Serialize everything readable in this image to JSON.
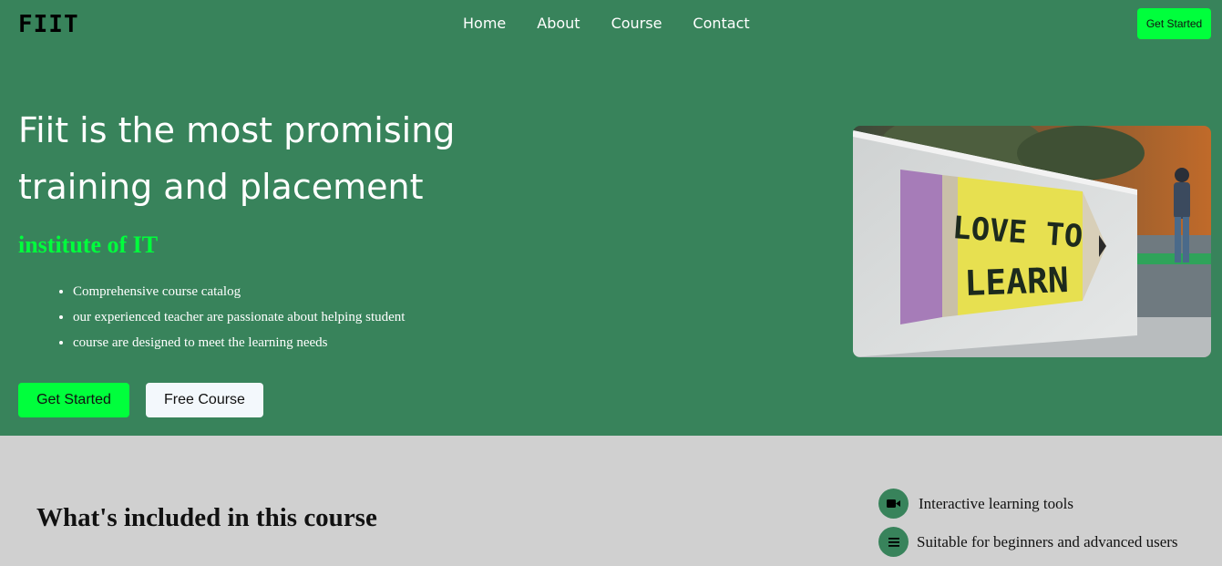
{
  "nav": {
    "logo": "FIIT",
    "links": [
      "Home",
      "About",
      "Course",
      "Contact"
    ],
    "cta_label": "Get Started"
  },
  "hero": {
    "title": "Fiit is the most promising training and placement",
    "subtitle": "institute of IT",
    "features": [
      "Comprehensive course catalog",
      "our experienced teacher are passionate about helping student",
      "course are designed to meet the learning needs"
    ],
    "primary_button": "Get Started",
    "secondary_button": "Free Course",
    "image_text_line1": "LOVE TO",
    "image_text_line2": "LEARN"
  },
  "course": {
    "heading": "What's included in this course",
    "items": [
      {
        "icon": "video-camera-icon",
        "label": "Interactive learning tools"
      },
      {
        "icon": "menu-lines-icon",
        "label": "Suitable for beginners and advanced users"
      }
    ]
  },
  "colors": {
    "hero_bg": "#38835b",
    "accent": "#00ff3c",
    "section_bg": "#d0d0d0",
    "light_button": "#f3f8fc"
  }
}
